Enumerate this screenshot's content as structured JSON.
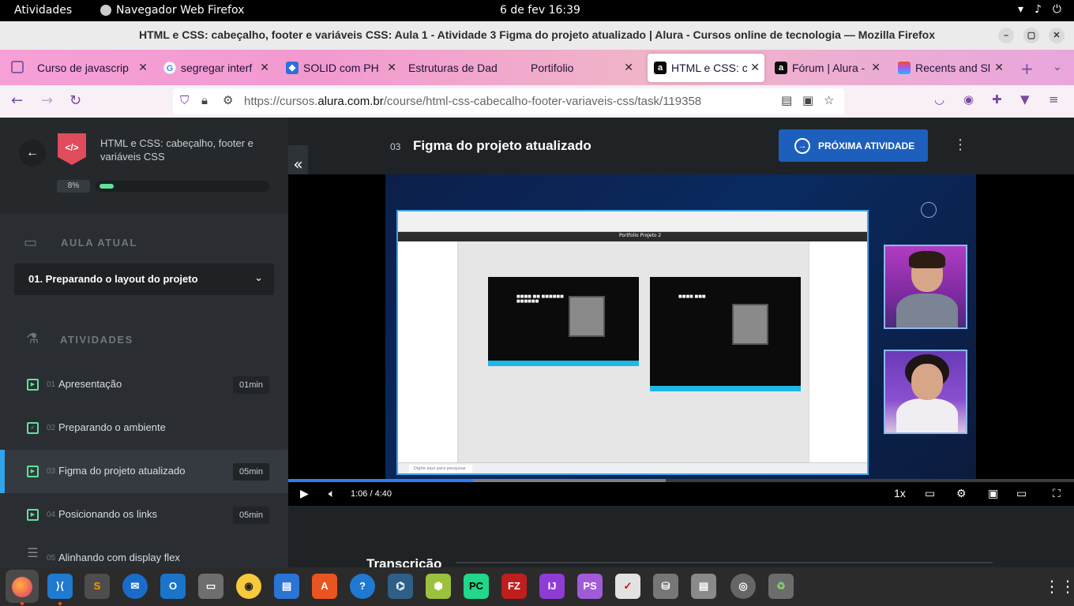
{
  "gnome": {
    "activities": "Atividades",
    "app_name": "Navegador Web Firefox",
    "clock": "6 de fev  16:39",
    "tray_icons": [
      "wifi-icon",
      "volume-icon",
      "power-icon"
    ]
  },
  "window": {
    "title": "HTML e CSS: cabeçalho, footer e variáveis CSS: Aula 1 - Atividade 3 Figma do projeto atualizado | Alura - Cursos online de tecnologia — Mozilla Firefox",
    "buttons": [
      "–",
      "▢",
      "✕"
    ]
  },
  "tabs": [
    {
      "label": "Curso de javascrip",
      "icon": "generic-tab-icon",
      "color": "#8b3a9a"
    },
    {
      "label": "segregar interf",
      "icon": "google-icon",
      "color": "#4285f4"
    },
    {
      "label": "SOLID com PH",
      "icon": "cube-icon",
      "color": "#2f6fd6"
    },
    {
      "label": "Estruturas de Dad",
      "icon": "",
      "color": ""
    },
    {
      "label": "Portifolio",
      "icon": "",
      "color": ""
    },
    {
      "label": "HTML e CSS: ca",
      "icon": "alura-icon",
      "color": "#0b0b0b"
    },
    {
      "label": "Fórum | Alura -",
      "icon": "alura-icon",
      "color": "#0b0b0b"
    },
    {
      "label": "Recents and Sl",
      "icon": "figma-icon",
      "color": "#1e1e1e"
    }
  ],
  "nav": {
    "url_prefix": "https://cursos.",
    "url_domain": "alura.com.br",
    "url_path": "/course/html-css-cabecalho-footer-variaveis-css/task/119358"
  },
  "sidebar": {
    "course_title": "HTML e CSS: cabeçalho, footer e variáveis CSS",
    "progress_label": "8%",
    "progress_value": 0.08,
    "section_current": "AULA ATUAL",
    "current_lesson": "01. Preparando o layout do projeto",
    "section_activities": "ATIVIDADES",
    "activities": [
      {
        "num": "01",
        "label": "Apresentação",
        "duration": "01min"
      },
      {
        "num": "02",
        "label": "Preparando o ambiente",
        "duration": ""
      },
      {
        "num": "03",
        "label": "Figma do projeto atualizado",
        "duration": "05min"
      },
      {
        "num": "04",
        "label": "Posicionando os links",
        "duration": "05min"
      },
      {
        "num": "05",
        "label": "Alinhando com display flex",
        "duration": ""
      }
    ]
  },
  "main": {
    "activity_num": "03",
    "activity_title": "Figma do projeto atualizado",
    "next_button": "PRÓXIMA ATIVIDADE",
    "transcript_heading": "Transcrição"
  },
  "video": {
    "current_time": "1:06",
    "separator": "/",
    "duration": "4:40",
    "speed": "1x",
    "played_fraction": 0.235,
    "buffered_fraction": 0.48,
    "screen": {
      "figma_project": "Portfolio Projeto 2",
      "taskbar_search": "Digite aqui para pesquisar"
    }
  },
  "dock": [
    "firefox",
    "vscode",
    "sublime",
    "thunderbird",
    "outlook",
    "files",
    "rhythmbox",
    "libreoffice-writer",
    "software",
    "help",
    "mysql-workbench",
    "cube",
    "pycharm",
    "filezilla",
    "intellij",
    "phpstorm",
    "tasks",
    "disks",
    "text-editor",
    "optical-drive",
    "trash"
  ]
}
